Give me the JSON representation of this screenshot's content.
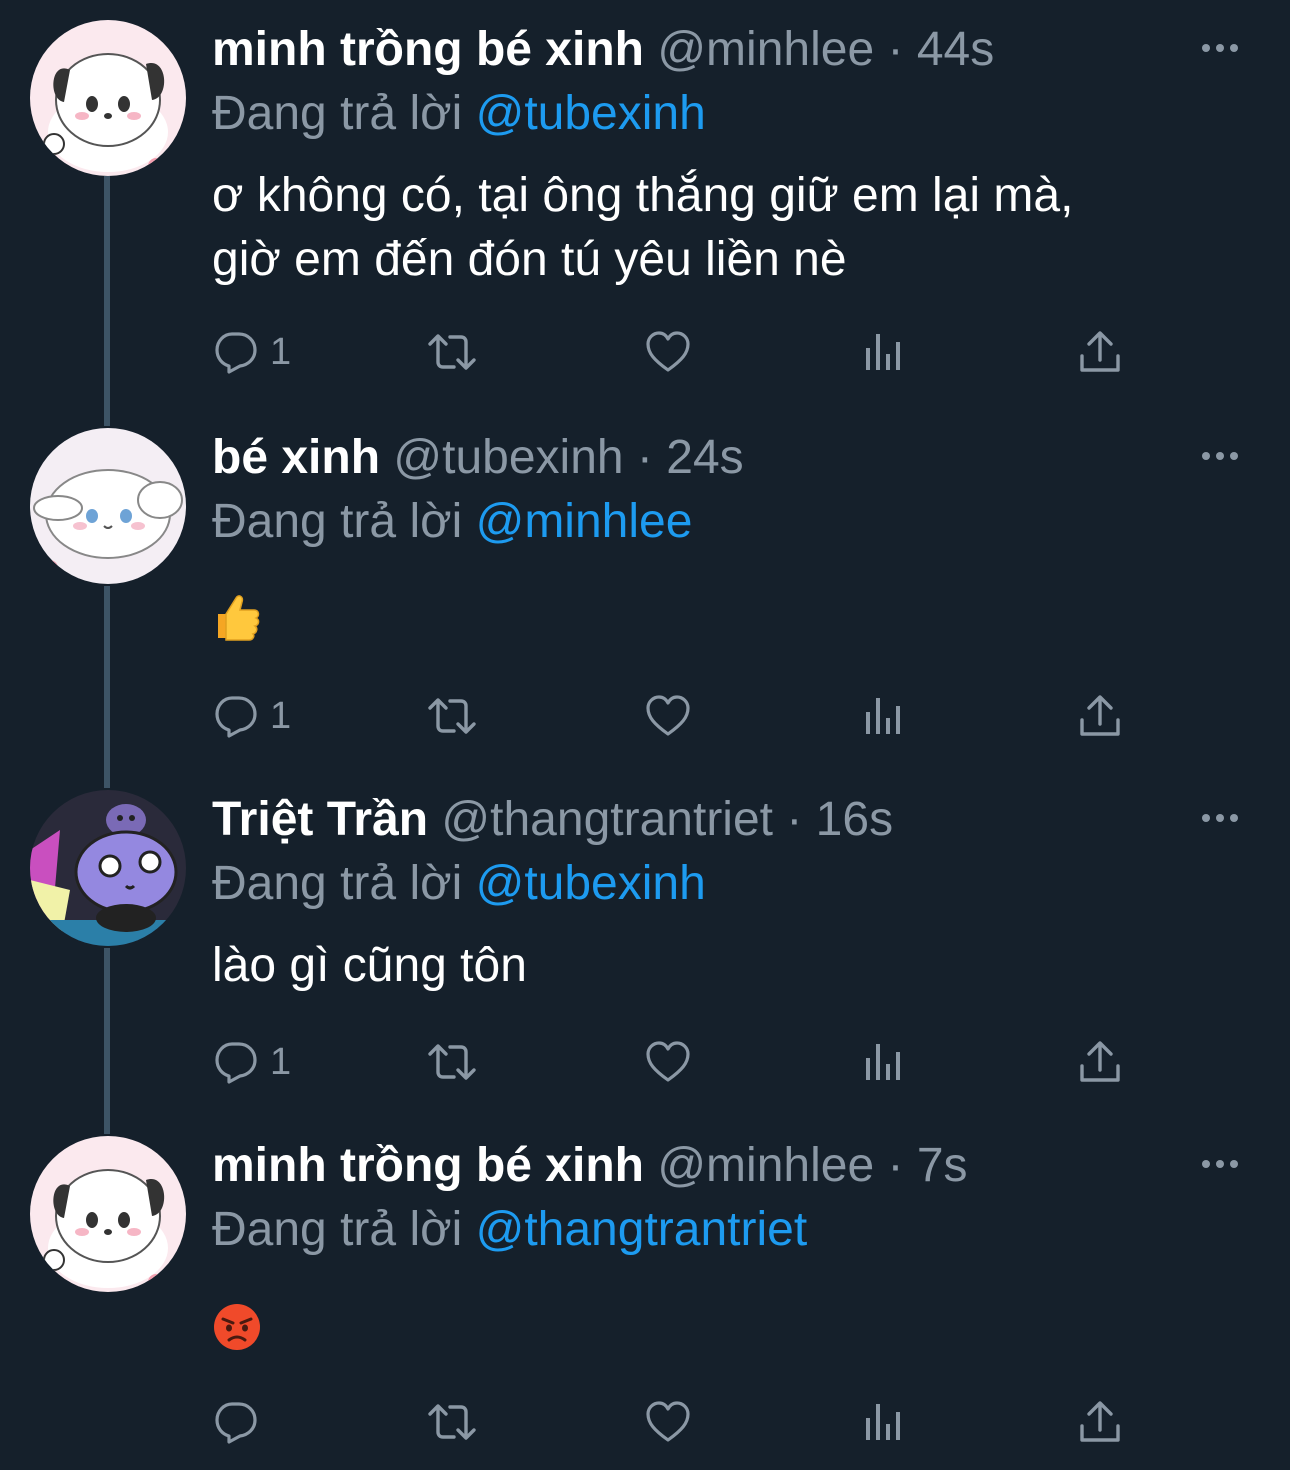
{
  "thread": [
    {
      "display_name": "minh trồng bé xinh",
      "handle": "@minhlee",
      "separator": "·",
      "time": "44s",
      "replying_prefix": "Đang trả lời",
      "replying_to": "@tubexinh",
      "text": "ơ không có, tại ông thắng giữ em lại mà,\ngiờ em đến đón tú yêu liền nè",
      "reply_count": "1",
      "avatar": "pochacco-avatar"
    },
    {
      "display_name": "bé xinh",
      "handle": "@tubexinh",
      "separator": "·",
      "time": "24s",
      "replying_prefix": "Đang trả lời",
      "replying_to": "@minhlee",
      "emoji": "thumbs-up",
      "reply_count": "1",
      "avatar": "cinnamoroll-avatar"
    },
    {
      "display_name": "Triệt Trần",
      "handle": "@thangtrantriet",
      "separator": "·",
      "time": "16s",
      "replying_prefix": "Đang trả lời",
      "replying_to": "@tubexinh",
      "text": "lào gì cũng tôn",
      "reply_count": "1",
      "avatar": "kuromi-avatar"
    },
    {
      "display_name": "minh trồng bé xinh",
      "handle": "@minhlee",
      "separator": "·",
      "time": "7s",
      "replying_prefix": "Đang trả lời",
      "replying_to": "@thangtrantriet",
      "emoji": "angry-face",
      "reply_count": "",
      "avatar": "pochacco-avatar"
    }
  ],
  "colors": {
    "background": "#15202b",
    "secondary_text": "#8b98a5",
    "link": "#1d9bf0",
    "thread_line": "#3d5466"
  },
  "icons": [
    "reply-icon",
    "retweet-icon",
    "like-icon",
    "views-icon",
    "share-icon",
    "more-icon"
  ]
}
